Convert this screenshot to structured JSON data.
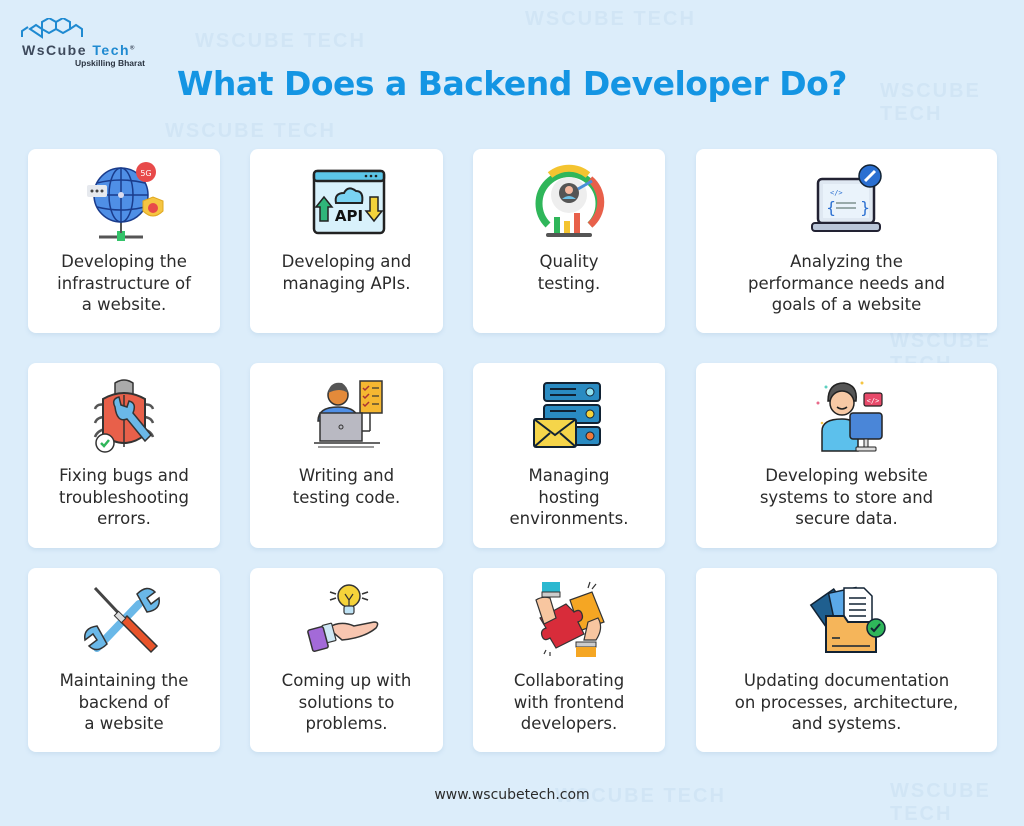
{
  "brand": {
    "name_part1": "WsCube",
    "name_part2": "Tech",
    "registered": "®",
    "tagline": "Upskilling Bharat",
    "accent_color": "#1495e3"
  },
  "title": "What Does a Backend Developer Do?",
  "watermark": "WSCUBE TECH",
  "cards": [
    {
      "label": "Developing the\ninfrastructure of\na website.",
      "icon": "globe-network-icon"
    },
    {
      "label": "Developing and\nmanaging APIs.",
      "icon": "api-icon"
    },
    {
      "label": "Quality\ntesting.",
      "icon": "quality-gauge-icon"
    },
    {
      "label": "Analyzing the\nperformance needs and\ngoals of a website",
      "icon": "laptop-code-icon"
    },
    {
      "label": "Fixing bugs and\ntroubleshooting\nerrors.",
      "icon": "bug-fix-icon"
    },
    {
      "label": "Writing and\ntesting code.",
      "icon": "developer-checklist-icon"
    },
    {
      "label": "Managing\nhosting\nenvironments.",
      "icon": "server-mail-icon"
    },
    {
      "label": "Developing website\nsystems to store and\nsecure data.",
      "icon": "developer-computer-icon"
    },
    {
      "label": "Maintaining the\nbackend of\na website",
      "icon": "tools-icon"
    },
    {
      "label": "Coming up with\nsolutions to\nproblems.",
      "icon": "idea-hand-icon"
    },
    {
      "label": "Collaborating\nwith frontend\ndevelopers.",
      "icon": "puzzle-collaboration-icon"
    },
    {
      "label": "Updating documentation\non processes, architecture,\nand systems.",
      "icon": "documents-folder-icon"
    }
  ],
  "footer": "www.wscubetech.com"
}
